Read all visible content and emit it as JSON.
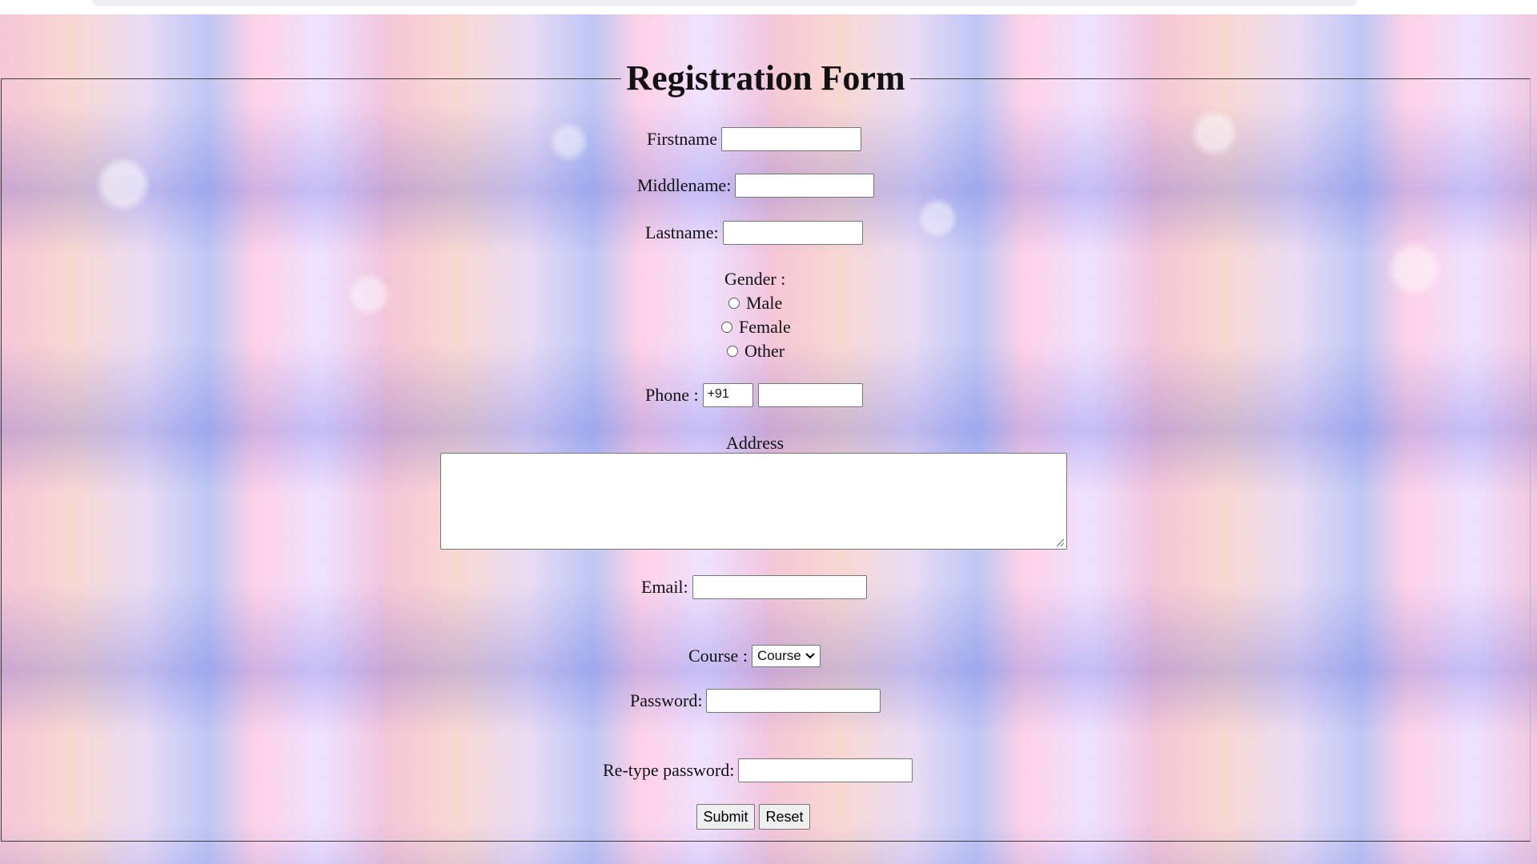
{
  "form": {
    "title": "Registration Form",
    "firstname_label": "Firstname",
    "middlename_label": "Middlename:",
    "lastname_label": "Lastname:",
    "gender_label": "Gender :",
    "gender_options": [
      "Male",
      "Female",
      "Other"
    ],
    "phone_label": "Phone :",
    "phone_code_value": "+91",
    "address_label": "Address",
    "email_label": "Email:",
    "course_label": "Course :",
    "course_selected": "Course",
    "password_label": "Password:",
    "retype_label": "Re-type password:",
    "submit_label": "Submit",
    "reset_label": "Reset"
  },
  "icons": {
    "select_arrow": "chevron-down-icon",
    "resize": "resize-handle-icon"
  }
}
